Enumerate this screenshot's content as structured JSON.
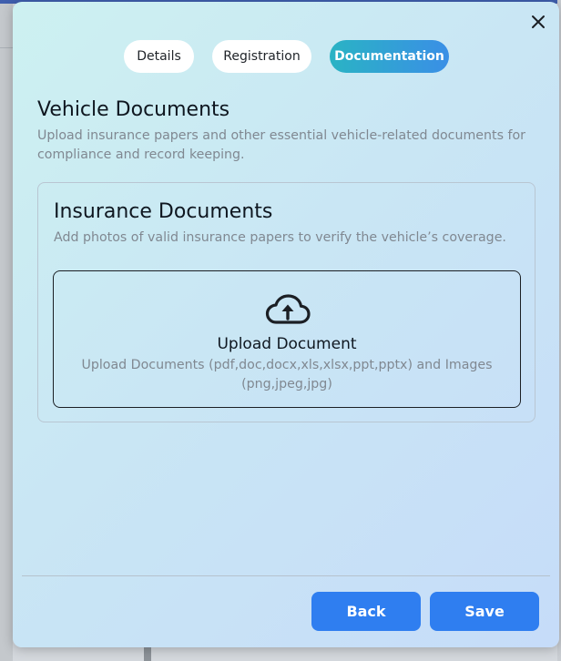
{
  "modal": {
    "tabs": [
      {
        "label": "Details",
        "active": false
      },
      {
        "label": "Registration",
        "active": false
      },
      {
        "label": "Documentation",
        "active": true
      }
    ],
    "section": {
      "title": "Vehicle Documents",
      "description": "Upload insurance papers and other essential vehicle-related documents for compliance and record keeping."
    },
    "card": {
      "title": "Insurance Documents",
      "description": "Add photos of valid insurance papers to verify the vehicle’s coverage.",
      "upload": {
        "icon": "cloud-upload-icon",
        "title": "Upload Document",
        "hint": "Upload Documents (pdf,doc,docx,xls,xlsx,ppt,pptx) and Images (png,jpeg,jpg)"
      }
    },
    "footer": {
      "back_label": "Back",
      "save_label": "Save"
    },
    "colors": {
      "primary_button": "#2f7ef0",
      "active_tab_start": "#2ab3c4",
      "active_tab_end": "#3a8fe6"
    }
  }
}
